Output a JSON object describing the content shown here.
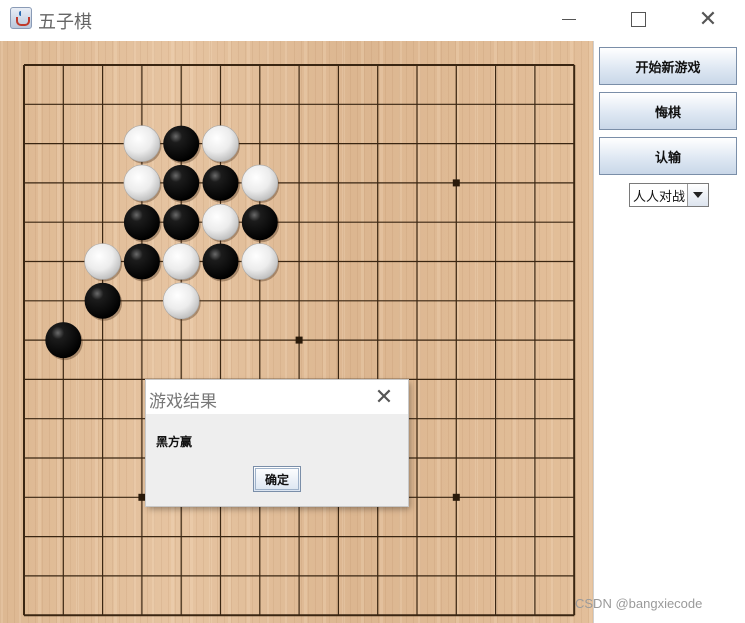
{
  "window": {
    "title": "五子棋",
    "icon": "java-cup-icon",
    "controls": [
      "minimize",
      "maximize",
      "close"
    ]
  },
  "board": {
    "size": 15,
    "line_color": "#3a2612",
    "wood_color": "#deb892",
    "star_points": [
      [
        3,
        11
      ],
      [
        7,
        7
      ],
      [
        11,
        3
      ],
      [
        11,
        11
      ]
    ],
    "black_stones": [
      [
        2,
        4
      ],
      [
        3,
        4
      ],
      [
        3,
        5
      ],
      [
        4,
        3
      ],
      [
        4,
        4
      ],
      [
        4,
        6
      ],
      [
        5,
        3
      ],
      [
        5,
        5
      ],
      [
        6,
        2
      ],
      [
        7,
        1
      ]
    ],
    "white_stones": [
      [
        2,
        3
      ],
      [
        2,
        5
      ],
      [
        3,
        3
      ],
      [
        3,
        6
      ],
      [
        4,
        5
      ],
      [
        5,
        2
      ],
      [
        5,
        4
      ],
      [
        5,
        6
      ],
      [
        6,
        4
      ]
    ]
  },
  "panel": {
    "new_game_label": "开始新游戏",
    "undo_label": "悔棋",
    "resign_label": "认输",
    "mode_selected": "人人对战"
  },
  "dialog": {
    "title": "游戏结果",
    "message": "黑方赢",
    "ok_label": "确定"
  },
  "watermark": "CSDN @bangxiecode"
}
